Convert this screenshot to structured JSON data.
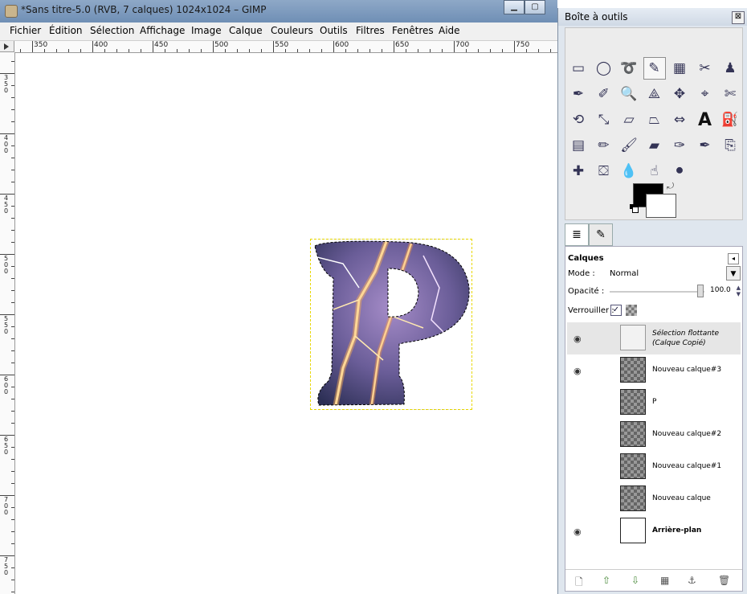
{
  "window": {
    "title": "*Sans titre-5.0 (RVB, 7 calques) 1024x1024 – GIMP",
    "min_btn": "▁",
    "max_btn": "▢"
  },
  "menu": [
    "Fichier",
    "Édition",
    "Sélection",
    "Affichage",
    "Image",
    "Calque",
    "Couleurs",
    "Outils",
    "Filtres",
    "Fenêtres",
    "Aide"
  ],
  "hruler_labels": [
    "350",
    "400",
    "450",
    "500",
    "550",
    "600",
    "650",
    "700",
    "750"
  ],
  "vruler_labels": [
    "350",
    "400",
    "450",
    "500",
    "550",
    "600",
    "650",
    "700",
    "750"
  ],
  "toolbox": {
    "title": "Boîte à outils",
    "close": "⊠",
    "tools": [
      {
        "name": "rect-select-icon",
        "glyph": "▭"
      },
      {
        "name": "ellipse-select-icon",
        "glyph": "◯"
      },
      {
        "name": "free-select-icon",
        "glyph": "➰"
      },
      {
        "name": "fuzzy-select-icon",
        "glyph": "✎"
      },
      {
        "name": "color-select-icon",
        "glyph": "▦"
      },
      {
        "name": "scissors-icon",
        "glyph": "✂"
      },
      {
        "name": "foreground-select-icon",
        "glyph": "♟"
      },
      {
        "name": "paths-icon",
        "glyph": "✒"
      },
      {
        "name": "color-picker-icon",
        "glyph": "✐"
      },
      {
        "name": "zoom-icon",
        "glyph": "🔍"
      },
      {
        "name": "measure-icon",
        "glyph": "⟁"
      },
      {
        "name": "move-icon",
        "glyph": "✥"
      },
      {
        "name": "align-icon",
        "glyph": "⌖"
      },
      {
        "name": "crop-icon",
        "glyph": "✄"
      },
      {
        "name": "rotate-icon",
        "glyph": "⟲"
      },
      {
        "name": "scale-icon",
        "glyph": "⤡"
      },
      {
        "name": "shear-icon",
        "glyph": "▱"
      },
      {
        "name": "perspective-icon",
        "glyph": "⏢"
      },
      {
        "name": "flip-icon",
        "glyph": "⇔"
      },
      {
        "name": "text-icon",
        "glyph": "A"
      },
      {
        "name": "bucket-fill-icon",
        "glyph": "⛽"
      },
      {
        "name": "blend-icon",
        "glyph": "▤"
      },
      {
        "name": "pencil-icon",
        "glyph": "✏"
      },
      {
        "name": "paintbrush-icon",
        "glyph": "🖌"
      },
      {
        "name": "eraser-icon",
        "glyph": "▰"
      },
      {
        "name": "airbrush-icon",
        "glyph": "✑"
      },
      {
        "name": "ink-icon",
        "glyph": "✒"
      },
      {
        "name": "clone-icon",
        "glyph": "⎘"
      },
      {
        "name": "heal-icon",
        "glyph": "✚"
      },
      {
        "name": "perspective-clone-icon",
        "glyph": "⛋"
      },
      {
        "name": "blur-icon",
        "glyph": "💧"
      },
      {
        "name": "smudge-icon",
        "glyph": "☝"
      },
      {
        "name": "dodge-burn-icon",
        "glyph": "⚫"
      }
    ]
  },
  "layers": {
    "title": "Calques",
    "mode_label": "Mode :",
    "mode_value": "Normal",
    "opacity_label": "Opacité :",
    "opacity_value": "100.0",
    "lock_label": "Verrouiller :",
    "items": [
      {
        "name": "Sélection flottante (Calque Copié)",
        "visible": true,
        "style": "float"
      },
      {
        "name": "Nouveau calque#3",
        "visible": true,
        "style": "trans"
      },
      {
        "name": "P",
        "visible": false,
        "style": "trans"
      },
      {
        "name": "Nouveau calque#2",
        "visible": false,
        "style": "trans"
      },
      {
        "name": "Nouveau calque#1",
        "visible": false,
        "style": "trans"
      },
      {
        "name": "Nouveau calque",
        "visible": false,
        "style": "trans"
      },
      {
        "name": "Arrière-plan",
        "visible": true,
        "style": "white"
      }
    ]
  }
}
